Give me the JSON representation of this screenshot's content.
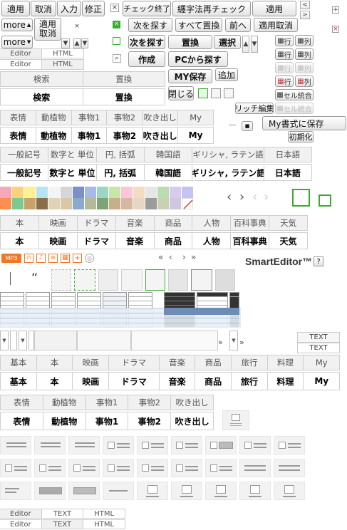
{
  "toolbar": {
    "apply": "適用",
    "cancel": "取消",
    "input": "入力",
    "fix": "修正",
    "check_done": "チェック終了",
    "hanja_check": "纒字法再チェック",
    "apply2": "適用",
    "more1": "more",
    "more2": "more",
    "apply_cancel_a": "適用",
    "apply_cancel_b": "取消",
    "find_next1": "次を探す",
    "replace_all": "すべて置換",
    "prev": "前へ",
    "apply_cancel": "適用取消",
    "find_next2": "次を探す",
    "replace": "置換",
    "select": "選択",
    "create": "作成",
    "find_from_pc": "PCから探す",
    "my_save": "MY保存",
    "add": "追加",
    "close": "閉じる",
    "row_label": "行",
    "col_label": "列",
    "cell_merge": "セル統合",
    "rich_edit": "リッチ編集",
    "my_format": "My書式に保存",
    "init": "初期化"
  },
  "mode_tabs": {
    "editor": "Editor",
    "html": "HTML"
  },
  "search_tabs": [
    "検索",
    "置換"
  ],
  "symbol_tabs": [
    "表情",
    "動植物",
    "事物1",
    "事物2",
    "吹き出し",
    "My"
  ],
  "char_tabs": [
    "一般記号",
    "数字と 単位",
    "円, 括弧",
    "韓国語",
    "ギリシャ, ラテン語",
    "日本語"
  ],
  "genre_tabs": [
    "本",
    "映画",
    "ドラマ",
    "音楽",
    "商品",
    "人物",
    "百科事典",
    "天気"
  ],
  "media_icons": [
    "MP3"
  ],
  "brand": "SmartEditor™",
  "help": "?",
  "text_labels": [
    "TEXT",
    "TEXT"
  ],
  "template_tabs": [
    "基本",
    "本",
    "映画",
    "ドラマ",
    "音楽",
    "商品",
    "旅行",
    "料理",
    "My"
  ],
  "symbol_tabs2": [
    "表情",
    "動植物",
    "事物1",
    "事物2",
    "吹き出し"
  ],
  "bottom_tabs": {
    "editor": "Editor",
    "text": "TEXT",
    "html": "HTML"
  },
  "nav_glyphs": {
    "first": "«",
    "prev": "‹",
    "next": "›",
    "last": "»",
    "quote": "“",
    "ff": "»"
  },
  "colors": {
    "accent_green": "#3cab2f",
    "brand_dark": "#333333",
    "mp3_orange": "#f47524"
  }
}
